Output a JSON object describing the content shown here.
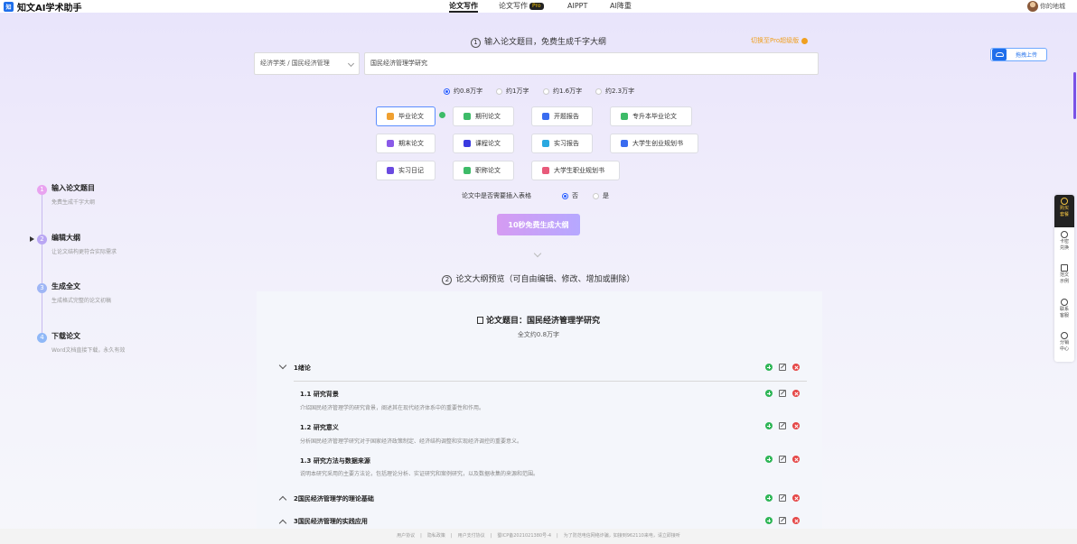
{
  "header": {
    "logo_mark": "知",
    "logo": "知文AI学术助手",
    "nav": [
      {
        "label": "论文写作"
      },
      {
        "label": "论文写作",
        "badge": "Pro"
      },
      {
        "label": "AIPPT"
      },
      {
        "label": "AI降重"
      }
    ],
    "user": "你的地城"
  },
  "upgrade": "切换至Pro超级版",
  "step1": {
    "num": "1",
    "label": "输入论文题目，免费生成千字大纲"
  },
  "upload_label": "拖拽上传",
  "form": {
    "category": "经济学类 / 国民经济管理",
    "title_value": "国民经济管理学研究"
  },
  "word_counts": [
    {
      "label": "约0.8万字",
      "selected": true
    },
    {
      "label": "约1万字",
      "selected": false
    },
    {
      "label": "约1.6万字",
      "selected": false
    },
    {
      "label": "约2.3万字",
      "selected": false
    }
  ],
  "paper_types": [
    {
      "label": "毕业论文",
      "color": "#f0a030"
    },
    {
      "label": "期刊论文",
      "color": "#3dbb68"
    },
    {
      "label": "开题报告",
      "color": "#3a6cf0"
    },
    {
      "label": "专升本毕业论文",
      "color": "#3dbb68"
    },
    {
      "label": "期末论文",
      "color": "#8a5ae8"
    },
    {
      "label": "课程论文",
      "color": "#3a3ae0"
    },
    {
      "label": "实习报告",
      "color": "#2aa8e0"
    },
    {
      "label": "大学生创业规划书",
      "color": "#3a6cf0"
    },
    {
      "label": "实习日记",
      "color": "#6a4ae0"
    },
    {
      "label": "职称论文",
      "color": "#3dbb68"
    },
    {
      "label": "大学生职业规划书",
      "color": "#e85a7a"
    }
  ],
  "table_question": {
    "label": "论文中是否需要插入表格",
    "options": [
      {
        "label": "否",
        "selected": true
      },
      {
        "label": "是",
        "selected": false
      }
    ]
  },
  "generate_button": "10秒免费生成大纲",
  "step2": {
    "num": "2",
    "label": "论文大纲预览（可自由编辑、修改、增加或删除）"
  },
  "outline": {
    "title": "论文题目：国民经济管理学研究",
    "subtitle": "全文约0.8万字",
    "chapters": [
      {
        "title": "1绪论"
      },
      {
        "title": "2国民经济管理学的理论基础"
      },
      {
        "title": "3国民经济管理的实践应用"
      }
    ],
    "sections": [
      {
        "title": "1.1 研究背景",
        "desc": "介绍国民经济管理学的研究背景，阐述其在现代经济体系中的重要性和作用。"
      },
      {
        "title": "1.2 研究意义",
        "desc": "分析国民经济管理学研究对于国家经济政策制定、经济结构调整和实现经济调控的重要意义。"
      },
      {
        "title": "1.3 研究方法与数据来源",
        "desc": "说明本研究采用的主要方法论，包括理论分析、实证研究和案例研究，以及数据收集的来源和范围。"
      }
    ]
  },
  "left_steps": [
    {
      "num": "1",
      "name": "输入论文题目",
      "desc": "免费生成千字大纲",
      "color": "#e9a3f0"
    },
    {
      "num": "2",
      "name": "编辑大纲",
      "desc": "让论文结构更符合实际需求",
      "color": "#b9a6f3"
    },
    {
      "num": "3",
      "name": "生成全文",
      "desc": "生成格式完整的论文初稿",
      "color": "#9fb6f5"
    },
    {
      "num": "4",
      "name": "下载论文",
      "desc": "Word文档直接下载，永久有效",
      "color": "#8fb8f7"
    }
  ],
  "side_panel": [
    {
      "label1": "购买",
      "label2": "套餐"
    },
    {
      "label1": "卡密",
      "label2": "兑换"
    },
    {
      "label1": "范文",
      "label2": "示例"
    },
    {
      "label1": "联系",
      "label2": "客服"
    },
    {
      "label1": "分销",
      "label2": "中心"
    }
  ],
  "footer": [
    "用户协议",
    "|",
    "隐私政策",
    "|",
    "用户支付协议",
    "|",
    "蜀ICP备2021021380号-4",
    "|",
    "为了防范电信网络诈骗，如接到962110来电，请立即接听"
  ]
}
